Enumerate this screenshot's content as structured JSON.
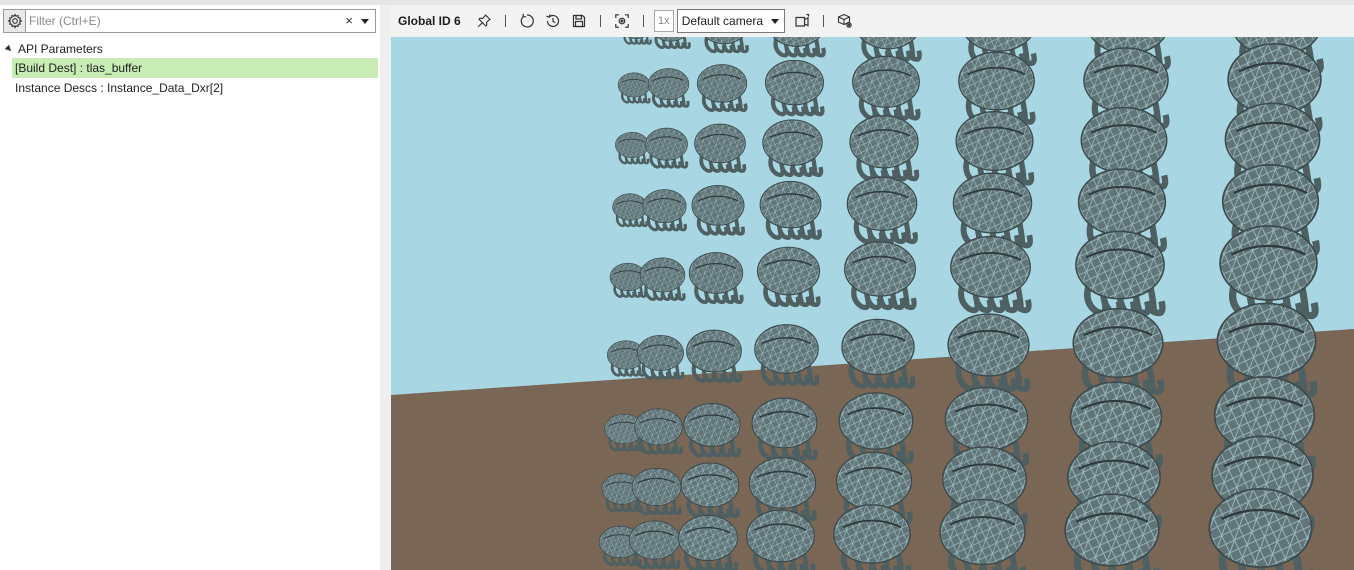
{
  "filter": {
    "placeholder": "Filter (Ctrl+E)",
    "value": "",
    "clear_symbol": "×"
  },
  "tree": {
    "root_label": "API Parameters",
    "items": [
      {
        "label": "[Build Dest] : tlas_buffer",
        "selected": true
      },
      {
        "label": "Instance Descs : Instance_Data_Dxr[2]",
        "selected": false
      }
    ]
  },
  "toolbar": {
    "title": "Global ID 6",
    "zoom_label": "1x",
    "camera_selected": "Default camera",
    "icons": [
      "pin-icon",
      "reset-icon",
      "history-icon",
      "save-icon",
      "capture-icon",
      "camera-swap-icon",
      "settings-cube-icon"
    ]
  },
  "colors": {
    "selected_row": "#c7edb4",
    "sky": "#a8d6e2",
    "ground": "#7a6655",
    "mesh_fill": "#5f7275",
    "mesh_highlight": "#b8dbe0"
  }
}
